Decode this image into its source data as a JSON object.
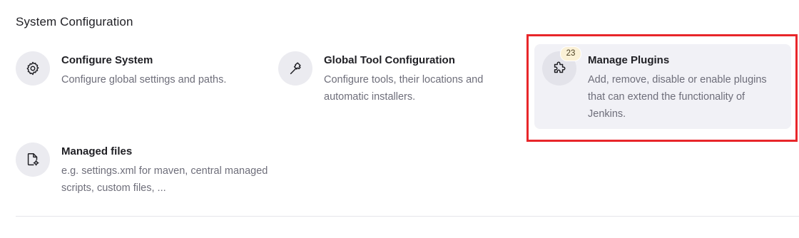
{
  "section": {
    "title": "System Configuration"
  },
  "items": [
    {
      "title": "Configure System",
      "description": "Configure global settings and paths.",
      "icon": "gear-icon"
    },
    {
      "title": "Global Tool Configuration",
      "description": "Configure tools, their locations and automatic installers.",
      "icon": "hammer-icon"
    },
    {
      "title": "Manage Plugins",
      "description": "Add, remove, disable or enable plugins that can extend the functionality of Jenkins.",
      "icon": "puzzle-icon",
      "badge": "23"
    },
    {
      "title": "Managed files",
      "description": "e.g. settings.xml for maven, central managed scripts, custom files, ...",
      "icon": "file-settings-icon"
    }
  ],
  "colors": {
    "highlight": "#e8262a",
    "badge_bg": "#fbf1d6",
    "hover_card_bg": "#f1f1f6",
    "icon_bg": "#ebebf0"
  }
}
